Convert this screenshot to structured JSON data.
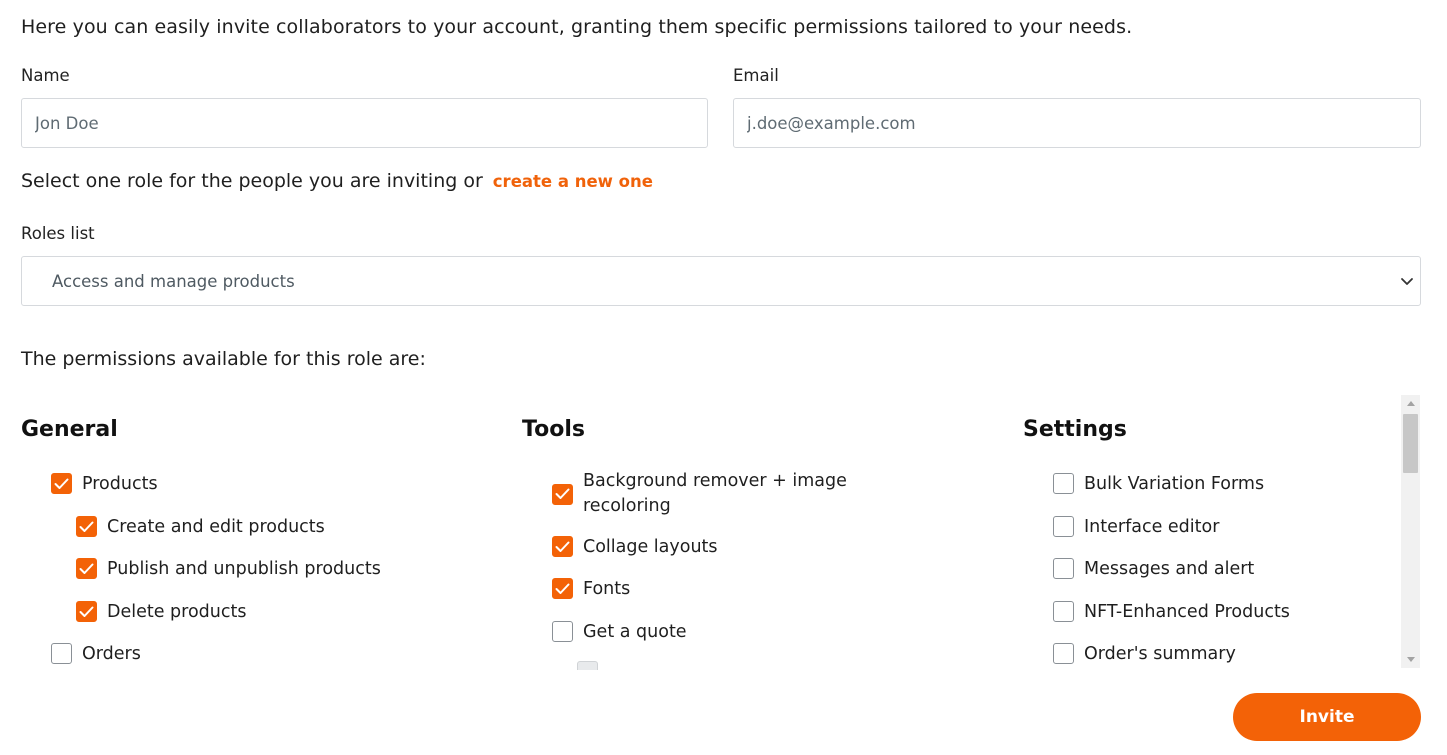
{
  "intro": "Here you can easily invite collaborators to your account, granting them specific permissions tailored to your needs.",
  "form": {
    "name_label": "Name",
    "name_placeholder": "Jon Doe",
    "email_label": "Email",
    "email_placeholder": "j.doe@example.com"
  },
  "role": {
    "prompt": "Select one role for the people you are inviting or",
    "create_link": "create a new one",
    "list_label": "Roles list",
    "selected": "Access and manage products"
  },
  "permissions_title": "The permissions available for this role are:",
  "columns": {
    "general": {
      "title": "General",
      "items": [
        {
          "label": "Products",
          "checked": true
        },
        {
          "label": "Create and edit products",
          "checked": true
        },
        {
          "label": "Publish and unpublish products",
          "checked": true
        },
        {
          "label": "Delete products",
          "checked": true
        },
        {
          "label": "Orders",
          "checked": false
        }
      ]
    },
    "tools": {
      "title": "Tools",
      "items": [
        {
          "label": "Background remover + image recoloring",
          "checked": true
        },
        {
          "label": "Collage layouts",
          "checked": true
        },
        {
          "label": "Fonts",
          "checked": true
        },
        {
          "label": "Get a quote",
          "checked": false
        }
      ]
    },
    "settings": {
      "title": "Settings",
      "items": [
        {
          "label": "Bulk Variation Forms",
          "checked": false
        },
        {
          "label": "Interface editor",
          "checked": false
        },
        {
          "label": "Messages and alert",
          "checked": false
        },
        {
          "label": "NFT-Enhanced Products",
          "checked": false
        },
        {
          "label": "Order's summary",
          "checked": false
        }
      ]
    }
  },
  "invite_label": "Invite",
  "colors": {
    "accent": "#f36207",
    "border": "#d6d9dd",
    "text": "#1f1f1f"
  }
}
